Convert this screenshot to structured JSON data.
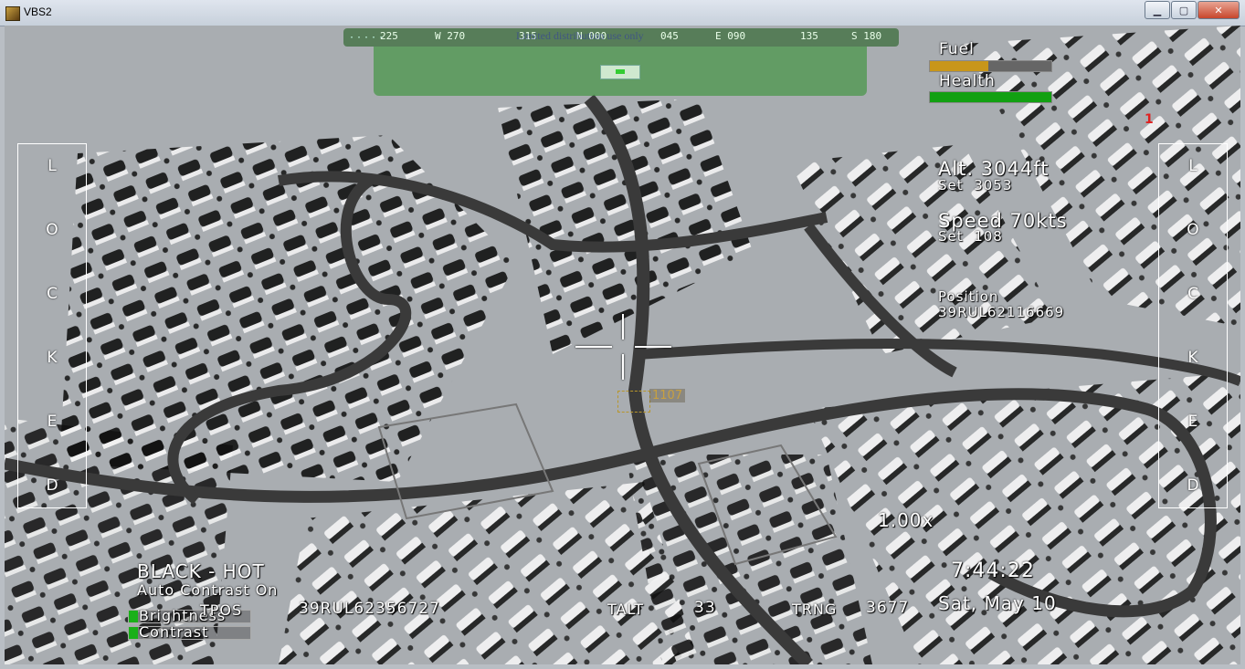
{
  "window": {
    "title": "VBS2"
  },
  "compass": {
    "labels": [
      "225",
      "W 270",
      "315",
      "N 000",
      "045",
      "E 090",
      "135",
      "S 180"
    ],
    "overlay_text": "Limited distribution use only"
  },
  "status": {
    "fuel_label": "Fuel",
    "fuel_level": 0.48,
    "health_label": "Health",
    "health_level": 1.0
  },
  "flight": {
    "alt_label": "Alt.",
    "alt_value": "3044ft",
    "alt_set_label": "Set",
    "alt_set_value": "3053",
    "speed_label": "Speed",
    "speed_value": "70kts",
    "speed_set_label": "Set",
    "speed_set_value": "108",
    "position_label": "Position",
    "position_value": "39RUL62116669"
  },
  "lock_left": [
    "L",
    "O",
    "C",
    "K",
    "E",
    "D"
  ],
  "lock_right": [
    "L",
    "O",
    "C",
    "K",
    "E",
    "D"
  ],
  "target": {
    "label": "1107"
  },
  "zoom": "1.00x",
  "clock": {
    "time": "7:44:22",
    "date": "Sat, May 10"
  },
  "sensor": {
    "mode": "BLACK - HOT",
    "contrast_mode": "Auto Contrast On",
    "brightness_label": "Brightness",
    "contrast_label": "Contrast",
    "tpos_label": "TPOS",
    "tpos_value": "39RUL62356727",
    "talt_label": "TALT",
    "talt_value": "33",
    "trng_label": "TRNG",
    "trng_value": "3677"
  },
  "marker": "1",
  "colors": {
    "fuel": "#c8961a",
    "health": "#12a012",
    "hud_green": "#3f8f3f",
    "target": "#c8a040"
  }
}
